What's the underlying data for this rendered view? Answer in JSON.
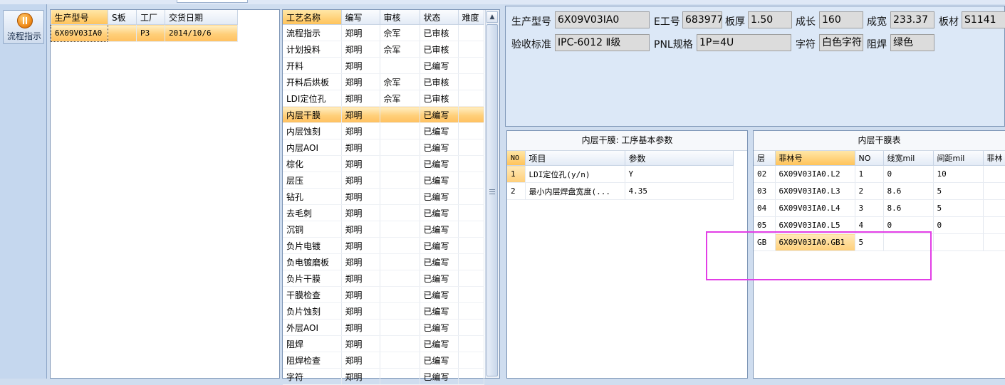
{
  "nav": {
    "flow_label": "流程指示"
  },
  "orders": {
    "columns": [
      "生产型号",
      "S板",
      "工厂",
      "交货日期"
    ],
    "rows": [
      {
        "model": "6X09V03IA0",
        "s_board": "",
        "factory": "P3",
        "date": "2014/10/6"
      }
    ]
  },
  "processes": {
    "columns": [
      "工艺名称",
      "编写",
      "审核",
      "状态",
      "难度"
    ],
    "rows": [
      {
        "name": "流程指示",
        "writer": "郑明",
        "reviewer": "佘军",
        "status": "已审核"
      },
      {
        "name": "计划投料",
        "writer": "郑明",
        "reviewer": "佘军",
        "status": "已审核"
      },
      {
        "name": "开料",
        "writer": "郑明",
        "reviewer": "",
        "status": "已编写"
      },
      {
        "name": "开料后烘板",
        "writer": "郑明",
        "reviewer": "佘军",
        "status": "已审核"
      },
      {
        "name": "LDI定位孔",
        "writer": "郑明",
        "reviewer": "佘军",
        "status": "已审核"
      },
      {
        "name": "内层干膜",
        "writer": "郑明",
        "reviewer": "",
        "status": "已编写"
      },
      {
        "name": "内层蚀刻",
        "writer": "郑明",
        "reviewer": "",
        "status": "已编写"
      },
      {
        "name": "内层AOI",
        "writer": "郑明",
        "reviewer": "",
        "status": "已编写"
      },
      {
        "name": "棕化",
        "writer": "郑明",
        "reviewer": "",
        "status": "已编写"
      },
      {
        "name": "层压",
        "writer": "郑明",
        "reviewer": "",
        "status": "已编写"
      },
      {
        "name": "钻孔",
        "writer": "郑明",
        "reviewer": "",
        "status": "已编写"
      },
      {
        "name": "去毛刺",
        "writer": "郑明",
        "reviewer": "",
        "status": "已编写"
      },
      {
        "name": "沉铜",
        "writer": "郑明",
        "reviewer": "",
        "status": "已编写"
      },
      {
        "name": "负片电镀",
        "writer": "郑明",
        "reviewer": "",
        "status": "已编写"
      },
      {
        "name": "负电镀磨板",
        "writer": "郑明",
        "reviewer": "",
        "status": "已编写"
      },
      {
        "name": "负片干膜",
        "writer": "郑明",
        "reviewer": "",
        "status": "已编写"
      },
      {
        "name": "干膜检查",
        "writer": "郑明",
        "reviewer": "",
        "status": "已编写"
      },
      {
        "name": "负片蚀刻",
        "writer": "郑明",
        "reviewer": "",
        "status": "已编写"
      },
      {
        "name": "外层AOI",
        "writer": "郑明",
        "reviewer": "",
        "status": "已编写"
      },
      {
        "name": "阻焊",
        "writer": "郑明",
        "reviewer": "",
        "status": "已编写"
      },
      {
        "name": "阻焊检查",
        "writer": "郑明",
        "reviewer": "",
        "status": "已编写"
      },
      {
        "name": "字符",
        "writer": "郑明",
        "reviewer": "",
        "status": "已编写"
      }
    ]
  },
  "header": {
    "model_label": "生产型号",
    "model_value": "6X09V03IA0",
    "e_label": "E工号",
    "e_value": "683977",
    "thickness_label": "板厚",
    "thickness_value": "1.50",
    "length_label": "成长",
    "length_value": "160",
    "width_label": "成宽",
    "width_value": "233.37",
    "material_label": "板材",
    "material_value": "S1141",
    "standard_label": "验收标准",
    "standard_value": "IPC-6012 Ⅱ级",
    "pnl_label": "PNL规格",
    "pnl_value": "1P=4U",
    "char_label": "字符",
    "char_value": "白色字符",
    "mask_label": "阻焊",
    "mask_value": "绿色"
  },
  "params": {
    "title": "内层干膜: 工序基本参数",
    "columns": [
      "NO",
      "项目",
      "参数"
    ],
    "rows": [
      {
        "no": "1",
        "item": "LDI定位孔(y/n)",
        "value": "Y"
      },
      {
        "no": "2",
        "item": "最小内层焊盘宽度(...",
        "value": "4.35"
      }
    ]
  },
  "films": {
    "title": "内层干膜表",
    "columns": [
      "层",
      "菲林号",
      "NO",
      "线宽mil",
      "间距mil",
      "菲林"
    ],
    "rows": [
      {
        "layer": "02",
        "film": "6X09V03IA0.L2",
        "no": "1",
        "width": "0",
        "spacing": "10"
      },
      {
        "layer": "03",
        "film": "6X09V03IA0.L3",
        "no": "2",
        "width": "8.6",
        "spacing": "5"
      },
      {
        "layer": "04",
        "film": "6X09V03IA0.L4",
        "no": "3",
        "width": "8.6",
        "spacing": "5"
      },
      {
        "layer": "05",
        "film": "6X09V03IA0.L5",
        "no": "4",
        "width": "0",
        "spacing": "0"
      },
      {
        "layer": "GB",
        "film": "6X09V03IA0.GB1",
        "no": "5",
        "width": "",
        "spacing": ""
      }
    ]
  }
}
